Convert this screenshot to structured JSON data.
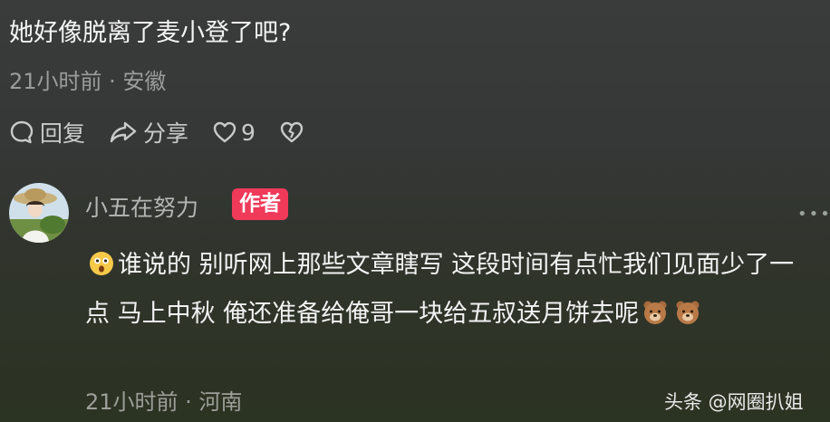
{
  "comment": {
    "text": "她好像脱离了麦小登了吧?",
    "meta": "21小时前 · 安徽",
    "actions": {
      "reply_label": "回复",
      "share_label": "分享",
      "like_count": "9"
    }
  },
  "reply": {
    "author": "小五在努力",
    "badge": "作者",
    "text_part1": "谁说的 别听网上那些文章瞎写 这段时间有点忙我们见面少了一点 马上中秋 俺还准备给俺哥一块给五叔送月饼去呢",
    "meta": "21小时前 · 河南",
    "icons": [
      "surprised-emoji-icon",
      "bear-emoji-icon",
      "bear-emoji-icon"
    ]
  },
  "watermark": "头条 @网圈扒姐",
  "colors": {
    "badge": "#f03a5a",
    "meta_text": "#9b9c9c",
    "action_text": "#c9caca"
  }
}
